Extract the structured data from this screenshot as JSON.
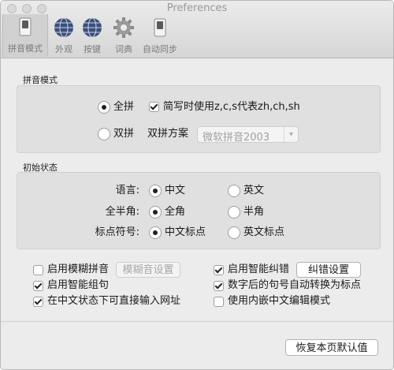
{
  "window": {
    "title": "Preferences"
  },
  "toolbar": {
    "items": [
      {
        "label": "拼音模式",
        "icon": "switch-icon"
      },
      {
        "label": "外观",
        "icon": "globe-icon"
      },
      {
        "label": "按键",
        "icon": "globe-icon"
      },
      {
        "label": "词典",
        "icon": "gear-icon"
      },
      {
        "label": "自动同步",
        "icon": "switch-icon"
      }
    ]
  },
  "pinyin_mode": {
    "section_title": "拼音模式",
    "full_pinyin_label": "全拼",
    "full_pinyin_selected": true,
    "abbrev_checkbox_label": "简写时使用z,c,s代表zh,ch,sh",
    "abbrev_checked": true,
    "double_pinyin_label": "双拼",
    "double_pinyin_selected": false,
    "scheme_label": "双拼方案",
    "scheme_value": "微软拼音2003"
  },
  "initial_state": {
    "section_title": "初始状态",
    "rows": [
      {
        "label": "语言:",
        "opt1": "中文",
        "opt2": "英文",
        "selected": 1
      },
      {
        "label": "全半角:",
        "opt1": "全角",
        "opt2": "半角",
        "selected": 1
      },
      {
        "label": "标点符号:",
        "opt1": "中文标点",
        "opt2": "英文标点",
        "selected": 1
      }
    ]
  },
  "options": {
    "fuzzy_label": "启用模糊拼音",
    "fuzzy_checked": false,
    "fuzzy_settings_button": "模糊音设置",
    "smart_group_label": "启用智能组句",
    "smart_group_checked": true,
    "url_input_label": "在中文状态下可直接输入网址",
    "url_input_checked": true,
    "smart_correct_label": "启用智能纠错",
    "smart_correct_checked": true,
    "correct_settings_button": "纠错设置",
    "period_convert_label": "数字后的句号自动转换为标点",
    "period_convert_checked": true,
    "inline_edit_label": "使用内嵌中文编辑模式",
    "inline_edit_checked": false
  },
  "footer": {
    "restore_button": "恢复本页默认值"
  },
  "colors": {
    "window_bg": "#ececec",
    "group_bg": "#e0e0e0",
    "toolbar_selected": "#d1d1d1"
  }
}
